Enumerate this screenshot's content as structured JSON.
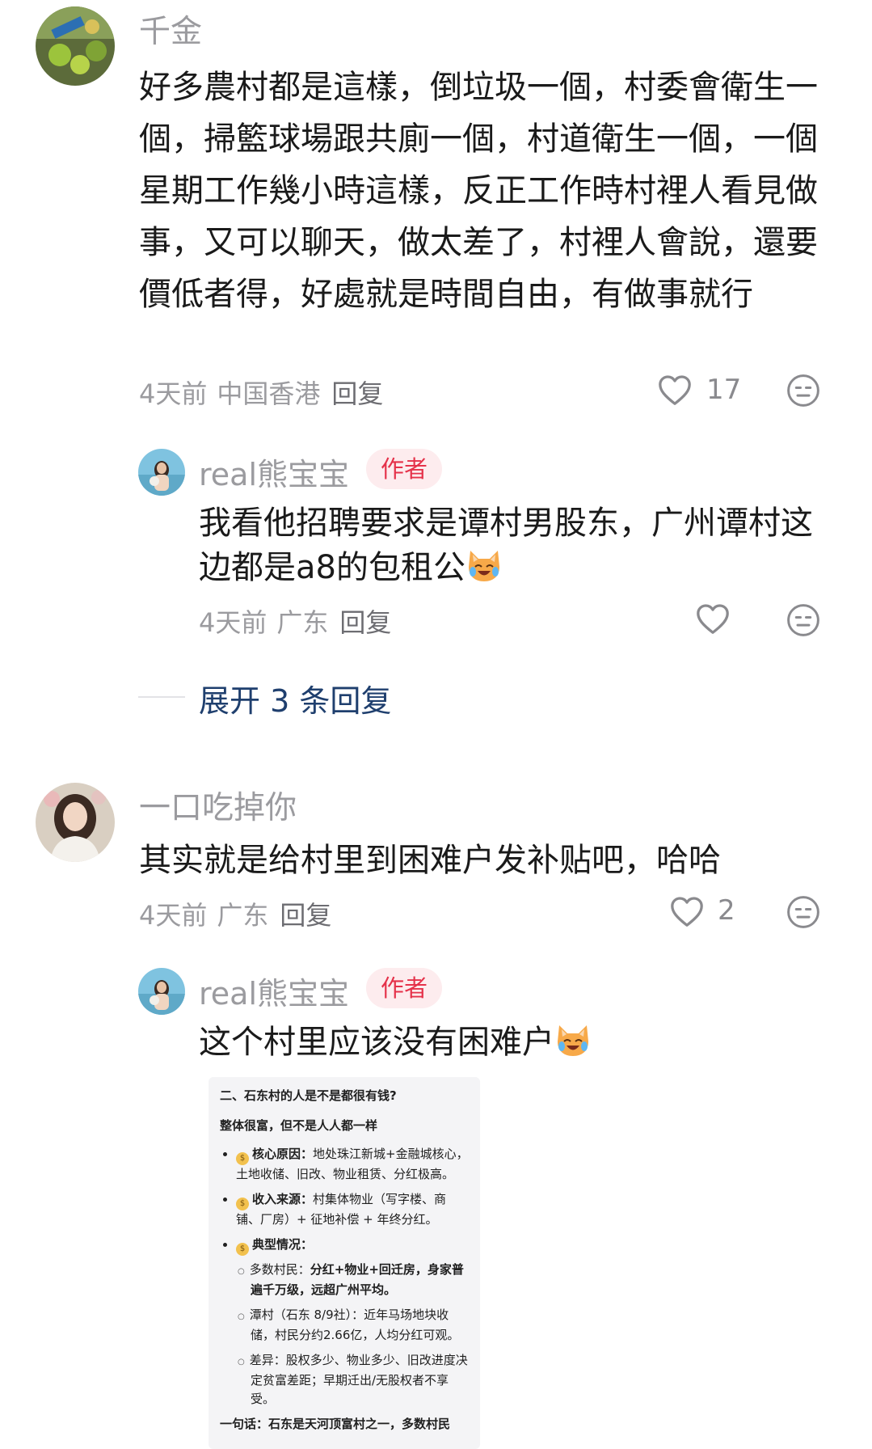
{
  "comments": [
    {
      "username": "千金",
      "text": "好多農村都是這樣，倒垃圾一個，村委會衛生一個，掃籃球場跟共廁一個，村道衛生一個，一個星期工作幾小時這樣，反正工作時村裡人看見做事，又可以聊天，做太差了，村裡人會說，還要價低者得，好處就是時間自由，有做事就行",
      "time": "4天前",
      "location": "中国香港",
      "reply_label": "回复",
      "likes": "17",
      "reply": {
        "username": "real熊宝宝",
        "badge": "作者",
        "text": "我看他招聘要求是谭村男股东，广州谭村这边都是a8的包租公",
        "time": "4天前",
        "location": "广东",
        "reply_label": "回复",
        "likes": ""
      },
      "expand_label": "展开 3 条回复"
    },
    {
      "username": "一口吃掉你",
      "text": "其实就是给村里到困难户发补贴吧，哈哈",
      "time": "4天前",
      "location": "广东",
      "reply_label": "回复",
      "likes": "2",
      "reply": {
        "username": "real熊宝宝",
        "badge": "作者",
        "text": "这个村里应该没有困难户",
        "time": "",
        "location": "",
        "reply_label": ""
      }
    }
  ],
  "embedded_image": {
    "heading": "二、石东村的人是不是都很有钱?",
    "subheading": "整体很富，但不是人人都一样",
    "bullets": [
      {
        "label": "核心原因：",
        "text": "地处珠江新城+金融城核心，土地收储、旧改、物业租赁、分红极高。"
      },
      {
        "label": "收入来源：",
        "text": "村集体物业（写字楼、商铺、厂房）+ 征地补偿 + 年终分红。"
      },
      {
        "label": "典型情况：",
        "text": ""
      }
    ],
    "sub_bullets": [
      {
        "label": "多数村民：",
        "text": "分红+物业+回迁房，身家普遍千万级，远超广州平均。"
      },
      {
        "label": "潭村（石东 8/9社）：",
        "text": "近年马场地块收储，村民分约2.66亿，人均分红可观。"
      },
      {
        "label": "差异：",
        "text": "股权多少、物业多少、旧改进度决定贫富差距；早期迁出/无股权者不享受。"
      }
    ],
    "summary": "一句话：石东是天河顶富村之一，多数村民"
  }
}
